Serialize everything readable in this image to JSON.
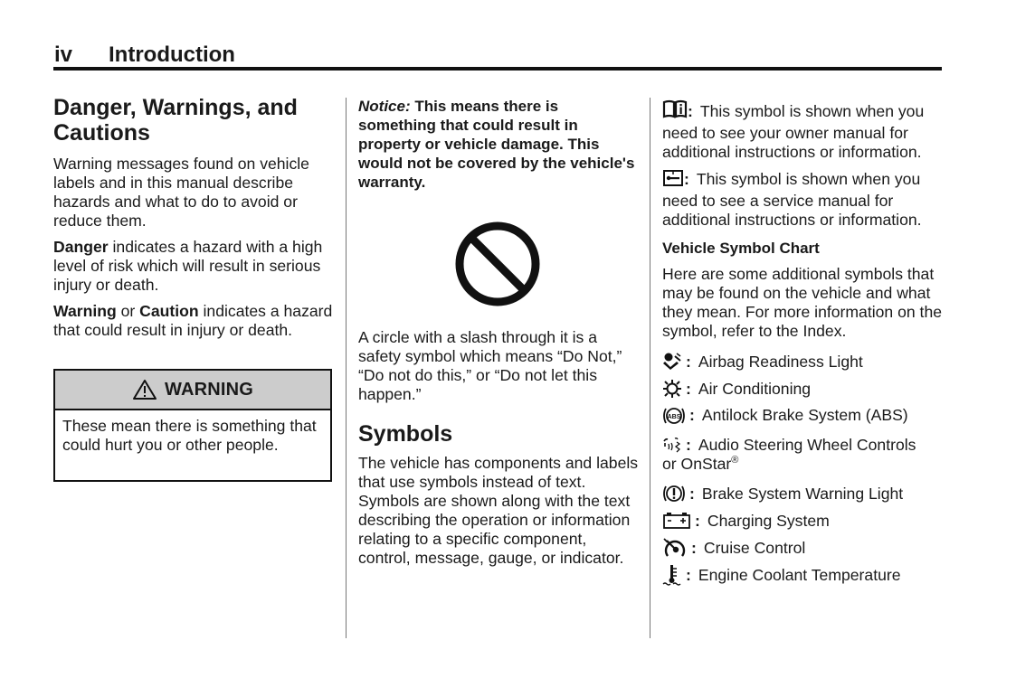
{
  "header": {
    "page_number": "iv",
    "title": "Introduction"
  },
  "column1": {
    "heading": "Danger, Warnings, and Cautions",
    "heading_line1": "Danger, Warnings, and",
    "heading_line2": "Cautions",
    "intro": "Warning messages found on vehicle labels and in this manual describe hazards and what to do to avoid or reduce them.",
    "danger_term": "Danger",
    "danger_text": " indicates a hazard with a high level of risk which will result in serious injury or death.",
    "warning_term": "Warning",
    "or_text": " or ",
    "caution_term": "Caution",
    "warning_text": " indicates a hazard that could result in injury or death.",
    "warning_box": {
      "icon": "warning-triangle-icon",
      "title": "WARNING",
      "body": "These mean there is something that could hurt you or other people."
    }
  },
  "column2": {
    "notice_label": "Notice:",
    "notice_text": " This means there is something that could result in property or vehicle damage. This would not be covered by the vehicle's warranty.",
    "no_symbol_icon": "prohibition-circle-icon",
    "no_symbol_text": "A circle with a slash through it is a safety symbol which means “Do Not,” “Do not do this,” or “Do not let this happen.”",
    "symbols_heading": "Symbols",
    "symbols_text": "The vehicle has components and labels that use symbols instead of text. Symbols are shown along with the text describing the operation or information relating to a specific component, control, message, gauge, or indicator."
  },
  "column3": {
    "owner_manual": {
      "icon": "owner-manual-book-icon",
      "text": "This symbol is shown when you need to see your owner manual for additional instructions or information."
    },
    "service_manual": {
      "icon": "service-manual-book-icon",
      "text": "This symbol is shown when you need to see a service manual for additional instructions or information."
    },
    "chart_heading": "Vehicle Symbol Chart",
    "chart_intro": "Here are some additional symbols that may be found on the vehicle and what they mean. For more information on the symbol, refer to the Index.",
    "colon": ":",
    "symbols": [
      {
        "icon": "airbag-icon",
        "label": "Airbag Readiness Light"
      },
      {
        "icon": "air-conditioning-icon",
        "label": "Air Conditioning"
      },
      {
        "icon": "abs-icon",
        "label": "Antilock Brake System (ABS)"
      },
      {
        "icon": "audio-steering-controls-icon",
        "label": "Audio Steering Wheel Controls",
        "continuation": "or OnStar",
        "superscript": "®"
      },
      {
        "icon": "brake-warning-icon",
        "label": "Brake System Warning Light"
      },
      {
        "icon": "battery-icon",
        "label": "Charging System"
      },
      {
        "icon": "cruise-control-icon",
        "label": "Cruise Control"
      },
      {
        "icon": "coolant-temperature-icon",
        "label": "Engine Coolant Temperature"
      }
    ]
  }
}
